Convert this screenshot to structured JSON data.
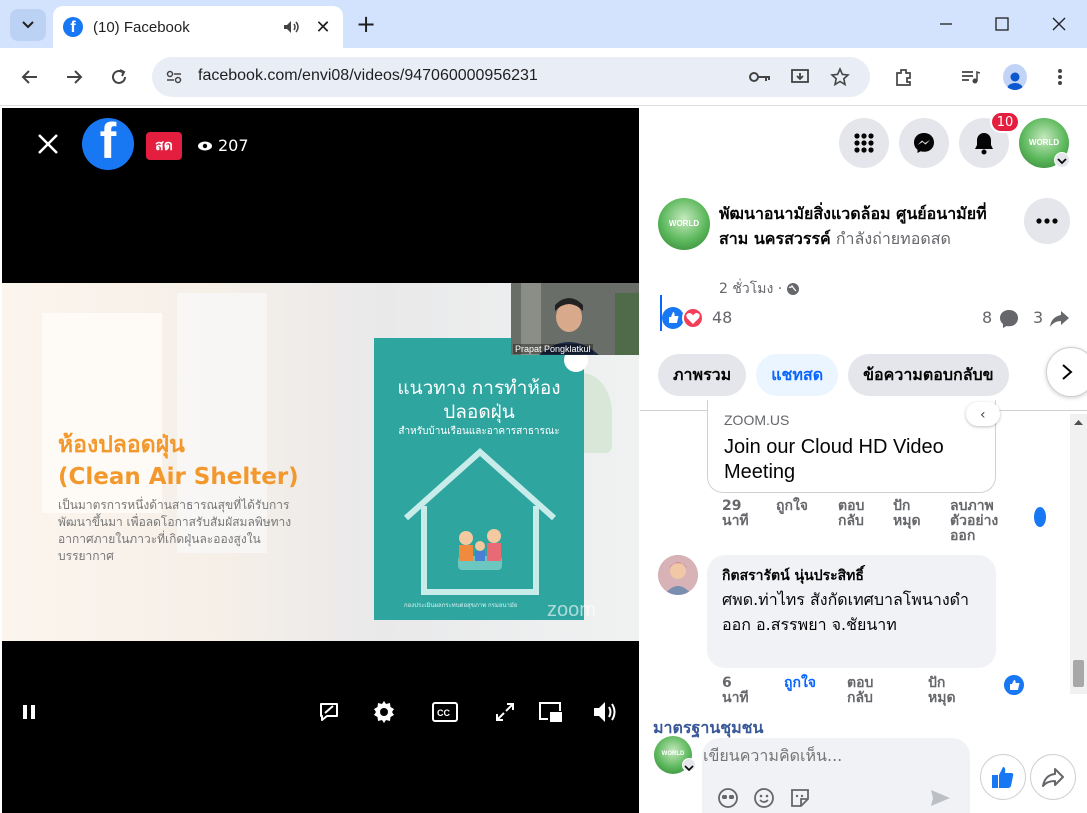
{
  "browser": {
    "tab_title": "(10) Facebook",
    "url": "facebook.com/envi08/videos/947060000956231",
    "favicon_letter": "f",
    "new_tab_label": "+"
  },
  "video": {
    "live_label": "สด",
    "viewer_count": "207",
    "logo_letter": "f",
    "slide": {
      "title_thai": "ห้องปลอดฝุ่น",
      "title_en": "(Clean Air Shelter)",
      "subtitle": "เป็นมาตรการหนึ่งด้านสาธารณสุขที่ได้รับการพัฒนาขึ้นมา เพื่อลดโอกาสรับสัมผัสมลพิษทางอากาศภายในภาวะที่เกิดฝุ่นละอองสูงในบรรยากาศ",
      "book_title": "แนวทาง การทำห้องปลอดฝุ่น",
      "book_subtitle": "สำหรับบ้านเรือนและอาคารสาธารณะ",
      "book_footer": "กองประเมินผลกระทบต่อสุขภาพ กรมอนามัย",
      "watermark": "zoom"
    },
    "camera_label": "Prapat Pongklatkul"
  },
  "header": {
    "notification_count": "10"
  },
  "post": {
    "page_name": "พัฒนาอนามัยสิ่งแวดล้อม ศูนย์อนามัยที่สาม นครสวรรค์",
    "status": " กำลังถ่ายทอดสด",
    "time": "2 ชั่วโมง ·",
    "reaction_count": "48",
    "comment_count": "8",
    "share_count": "3",
    "logo_text": "WORLD"
  },
  "tabs": [
    {
      "label": "ภาพรวม",
      "active": false
    },
    {
      "label": "แชทสด",
      "active": true
    },
    {
      "label": "ข้อความตอบกลับข",
      "active": false
    }
  ],
  "link_preview": {
    "domain": "ZOOM.US",
    "title": "Join our Cloud HD Video Meeting",
    "actions": {
      "time": "29 นาที",
      "like": "ถูกใจ",
      "reply": "ตอบกลับ",
      "hide": "ปักหมุด",
      "remove": "ลบภาพตัวอย่างออก"
    }
  },
  "comment": {
    "author": "กิตสรารัตน์ นุ่นประสิทธิ์",
    "text": "ศพด.ท่าไทร สังกัดเทศบาลโพนางดำออก อ.สรรพยา จ.ชัยนาท",
    "actions": {
      "time": "6 นาที",
      "like": "ถูกใจ",
      "reply": "ตอบกลับ",
      "hide": "ปักหมุด"
    }
  },
  "bottom": {
    "partial_name": "มาตรฐานชุมชน",
    "composer_placeholder": "เขียนความคิดเห็น..."
  },
  "colors": {
    "facebook_blue": "#1877f2",
    "live_red": "#e41e3f",
    "link_blue": "#0866ff"
  }
}
